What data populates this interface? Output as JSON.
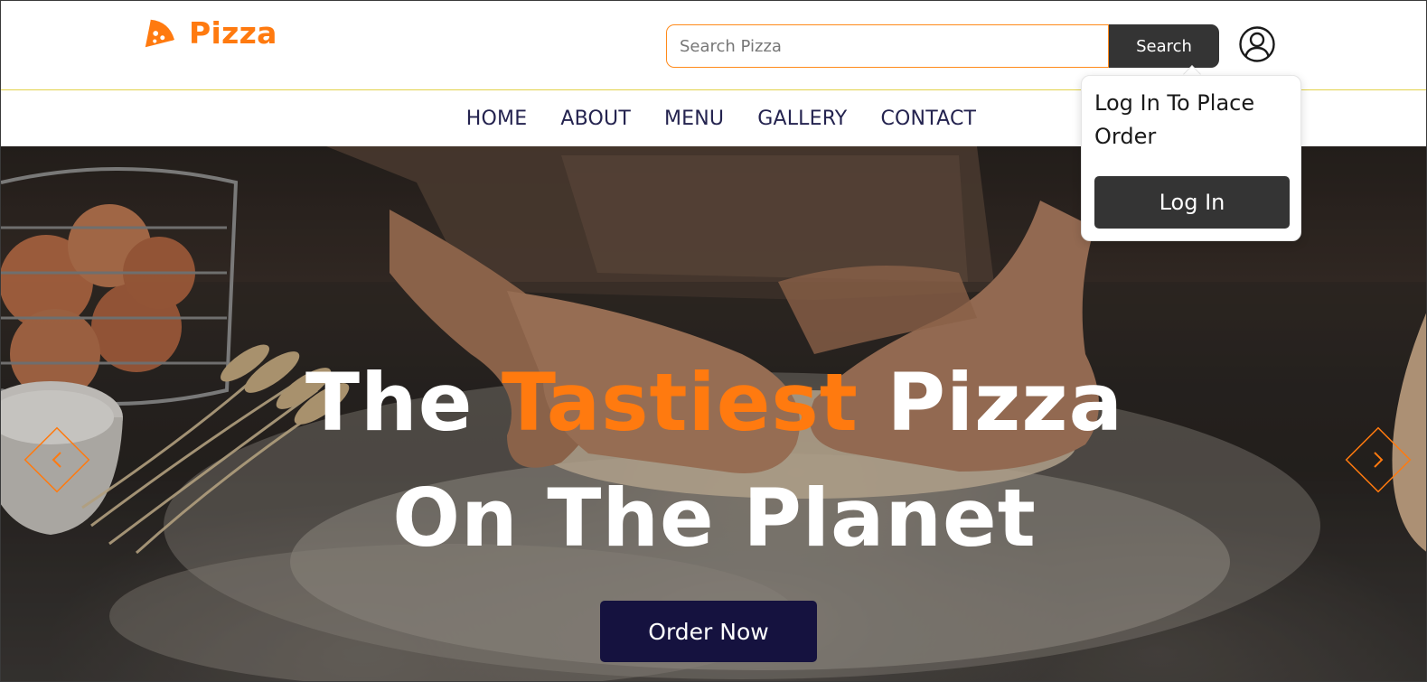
{
  "header": {
    "logo_text": "Pizza",
    "logo_icon": "pizza-slice-icon",
    "search_placeholder": "Search Pizza",
    "search_value": "",
    "search_button": "Search",
    "user_icon": "user-circle-icon"
  },
  "nav": {
    "items": [
      {
        "label": "HOME"
      },
      {
        "label": "ABOUT"
      },
      {
        "label": "MENU"
      },
      {
        "label": "GALLERY"
      },
      {
        "label": "CONTACT"
      }
    ]
  },
  "hero": {
    "title_word1": "The ",
    "title_accent": "Tastiest",
    "title_word2": " Pizza",
    "title_line2": "On The Planet",
    "order_button": "Order Now",
    "prev_icon": "chevron-left-icon",
    "next_icon": "chevron-right-icon"
  },
  "login_popover": {
    "message": "Log In To Place Order",
    "button": "Log In"
  },
  "colors": {
    "accent": "#ff7a0f",
    "dark_button": "#343434",
    "order_button": "#15123f",
    "nav_text": "#24234f"
  }
}
